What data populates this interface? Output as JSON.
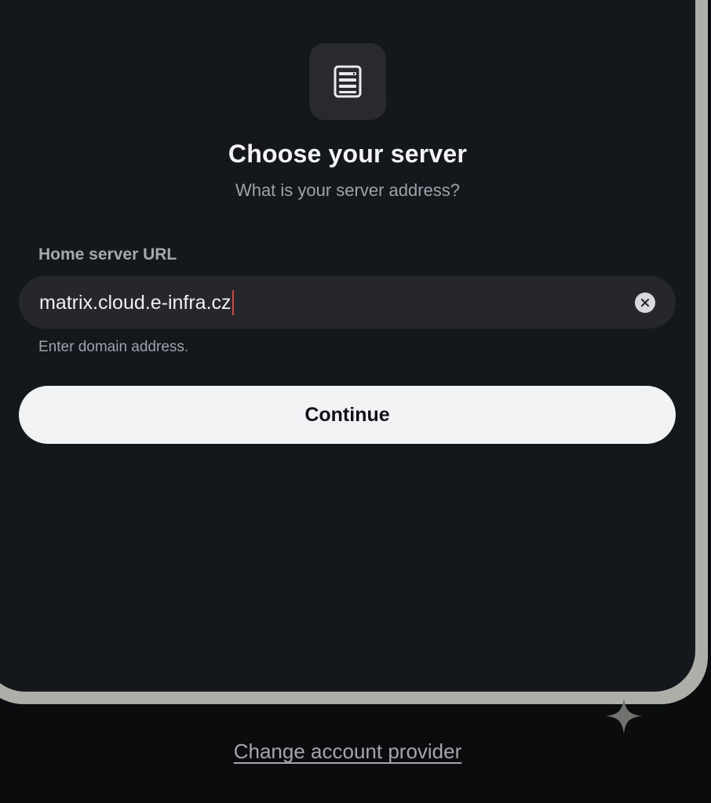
{
  "header": {
    "icon": "server-icon",
    "title": "Choose your server",
    "subtitle": "What is your server address?"
  },
  "form": {
    "field_label": "Home server URL",
    "url_value": "matrix.cloud.e-infra.cz",
    "clear_icon": "close-circle-icon",
    "hint": "Enter domain address.",
    "continue_label": "Continue"
  },
  "footer": {
    "change_provider_label": "Change account provider",
    "sparkle_icon": "sparkle-icon"
  },
  "colors": {
    "background": "#0b0c0e",
    "card": "#14171c",
    "input": "#25272c",
    "primary_button": "#f1f2f4",
    "caret": "#d9453d"
  }
}
